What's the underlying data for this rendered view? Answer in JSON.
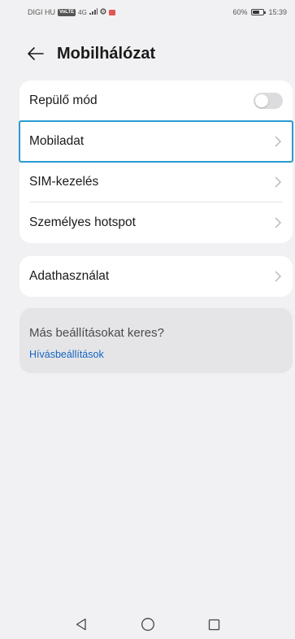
{
  "status_bar": {
    "carrier": "DIGI HU",
    "badge": "VoLTE",
    "network": "4G",
    "battery": "60%",
    "battery_level": 0.6,
    "time": "15:39"
  },
  "header": {
    "title": "Mobilhálózat"
  },
  "settings": {
    "items": [
      {
        "label": "Repülő mód",
        "control": "toggle",
        "toggle_on": false
      },
      {
        "label": "Mobiladat",
        "control": "chevron",
        "selected": true
      },
      {
        "label": "SIM-kezelés",
        "control": "chevron"
      },
      {
        "label": "Személyes hotspot",
        "control": "chevron"
      }
    ],
    "data_usage": {
      "label": "Adathasználat"
    }
  },
  "suggestions": {
    "title": "Más beállításokat keres?",
    "link": "Hívásbeállítások"
  },
  "colors": {
    "accent": "#2a9bd1",
    "link": "#1565c0",
    "background": "#f1f1f3"
  },
  "icons": {
    "back": "arrow-left-icon",
    "chevron": "chevron-right-icon",
    "nav_back": "triangle-back-icon",
    "nav_home": "circle-home-icon",
    "nav_recent": "square-recent-icon"
  }
}
